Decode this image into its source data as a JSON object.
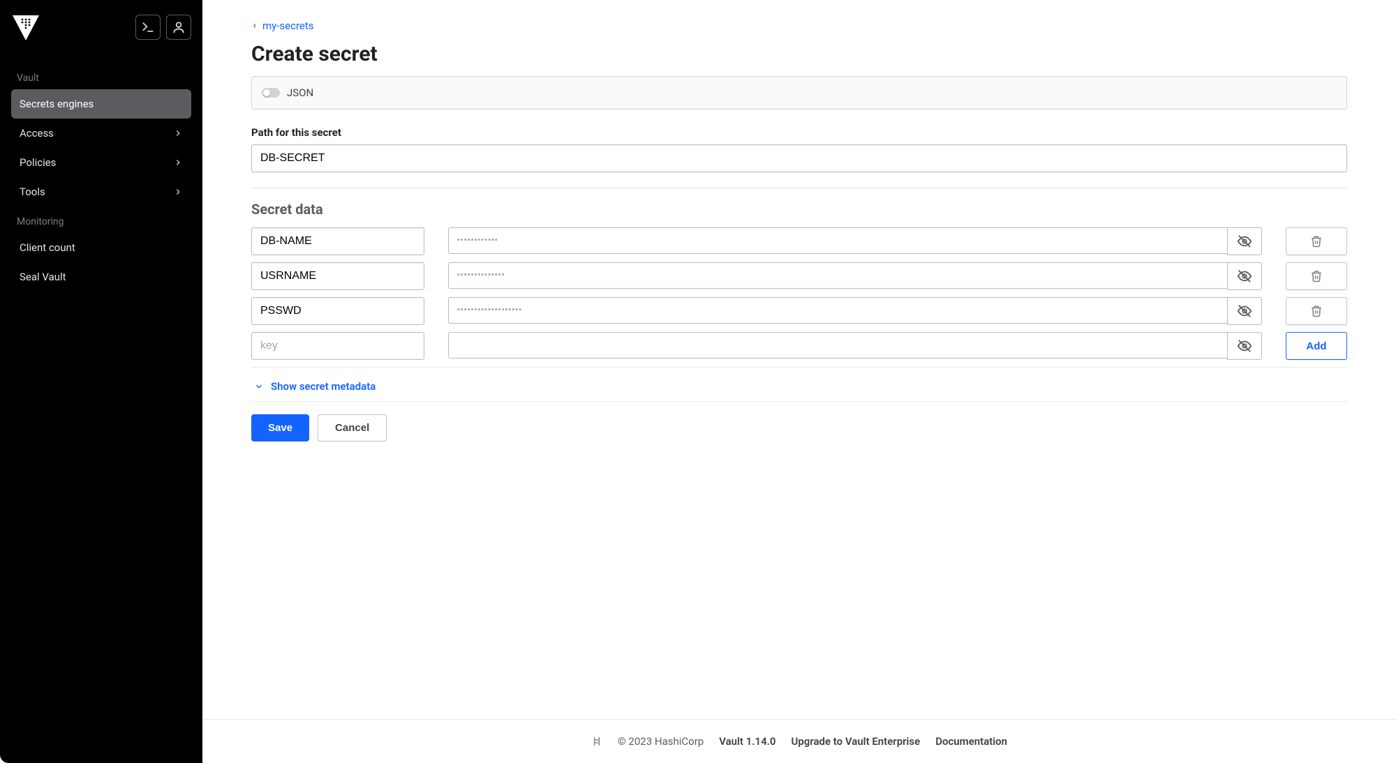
{
  "sidebar": {
    "section1": "Vault",
    "items1": [
      "Secrets engines",
      "Access",
      "Policies",
      "Tools"
    ],
    "section2": "Monitoring",
    "items2": [
      "Client count",
      "Seal Vault"
    ]
  },
  "breadcrumb": "my-secrets",
  "page_title": "Create secret",
  "json_toggle_label": "JSON",
  "path_label": "Path for this secret",
  "path_value": "DB-SECRET",
  "secret_data_heading": "Secret data",
  "rows": [
    {
      "key": "DB-NAME",
      "mask": "▪▪▪▪▪▪▪▪▪▪▪▪"
    },
    {
      "key": "USRNAME",
      "mask": "▪▪▪▪▪▪▪▪▪▪▪▪▪▪"
    },
    {
      "key": "PSSWD",
      "mask": "▪▪▪▪▪▪▪▪▪▪▪▪▪▪▪▪▪▪▪"
    }
  ],
  "new_row_placeholder": "key",
  "add_label": "Add",
  "metadata_toggle": "Show secret metadata",
  "save": "Save",
  "cancel": "Cancel",
  "footer": {
    "copyright": "© 2023 HashiCorp",
    "version": "Vault 1.14.0",
    "upgrade": "Upgrade to Vault Enterprise",
    "docs": "Documentation"
  }
}
